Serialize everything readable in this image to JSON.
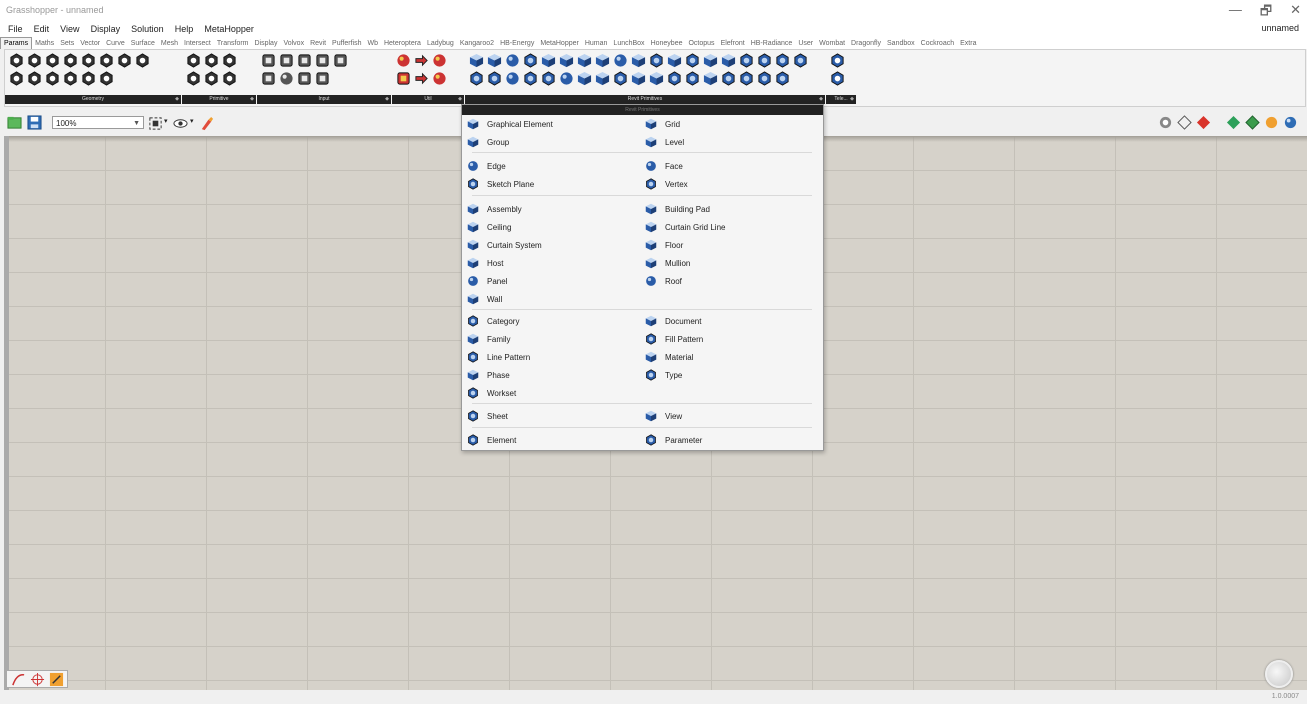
{
  "window": {
    "title": "Grasshopper - unnamed",
    "doc_name": "unnamed",
    "minimize": "—",
    "restore": "🗗",
    "close": "✕"
  },
  "menu": [
    "File",
    "Edit",
    "View",
    "Display",
    "Solution",
    "Help",
    "MetaHopper"
  ],
  "tabs": [
    "Params",
    "Maths",
    "Sets",
    "Vector",
    "Curve",
    "Surface",
    "Mesh",
    "Intersect",
    "Transform",
    "Display",
    "Volvox",
    "Revit",
    "Pufferfish",
    "Wb",
    "Heteroptera",
    "Ladybug",
    "Kangaroo2",
    "HB-Energy",
    "MetaHopper",
    "Human",
    "LunchBox",
    "Honeybee",
    "Octopus",
    "Elefront",
    "HB-Radiance",
    "User",
    "Wombat",
    "Dragonfly",
    "Sandbox",
    "Cockroach",
    "Extra"
  ],
  "active_tab": "Params",
  "ribbon_groups": [
    "Geometry",
    "Primitive",
    "Input",
    "Util",
    "Revit Primitives",
    "Tele..."
  ],
  "toolbar": {
    "zoom": "100%"
  },
  "dropdown": {
    "header": "Revit Primitives",
    "left": [
      "Graphical Element",
      "Group",
      "Edge",
      "Sketch Plane",
      "Assembly",
      "Ceiling",
      "Curtain System",
      "Host",
      "Panel",
      "Wall",
      "Category",
      "Family",
      "Line Pattern",
      "Phase",
      "Workset",
      "Sheet",
      "Element"
    ],
    "right": [
      "Grid",
      "Level",
      "Face",
      "Vertex",
      "Building Pad",
      "Curtain Grid Line",
      "Floor",
      "Mullion",
      "Roof",
      "Document",
      "Fill Pattern",
      "Material",
      "Type",
      "View",
      "Parameter"
    ]
  },
  "status": {
    "version": "1.0.0007"
  },
  "colors": {
    "canvas": "#d6d2ca",
    "icon_blue": "#2a5ca8",
    "ribbon_label_bg": "#232323"
  },
  "icons": [
    "hexagon-param-icon",
    "cube-param-icon",
    "sphere-param-icon",
    "gear-icon",
    "eye-icon",
    "paint-brush-icon",
    "save-icon",
    "open-file-icon",
    "navigation-wheel-icon"
  ]
}
